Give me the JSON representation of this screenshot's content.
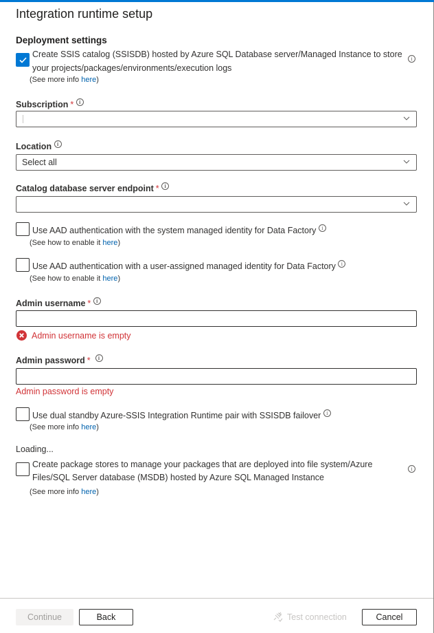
{
  "header": {
    "title": "Integration runtime setup",
    "accent_color": "#0078d4"
  },
  "section": {
    "title": "Deployment settings"
  },
  "ssisdb_checkbox": {
    "checked": true,
    "line1": "Create SSIS catalog (SSISDB) hosted by Azure SQL Database server/Managed Instance to store",
    "line2": "your projects/packages/environments/execution logs",
    "sub_prefix": "(See more info ",
    "sub_link": "here",
    "sub_suffix": ")"
  },
  "subscription": {
    "label": "Subscription",
    "required": "*",
    "value": ""
  },
  "location": {
    "label": "Location",
    "value": "Select all"
  },
  "endpoint": {
    "label": "Catalog database server endpoint",
    "required": "*",
    "value": ""
  },
  "aad_system": {
    "checked": false,
    "label": "Use AAD authentication with the system managed identity for Data Factory",
    "sub_prefix": "(See how to enable it ",
    "sub_link": "here",
    "sub_suffix": ")"
  },
  "aad_user": {
    "checked": false,
    "label": "Use AAD authentication with a user-assigned managed identity for Data Factory",
    "sub_prefix": "(See how to enable it ",
    "sub_link": "here",
    "sub_suffix": ")"
  },
  "admin_username": {
    "label": "Admin username",
    "required": "*",
    "value": "",
    "error": "Admin username is empty"
  },
  "admin_password": {
    "label": "Admin password",
    "required": "*",
    "value": "",
    "error": "Admin password is empty"
  },
  "dual_standby": {
    "checked": false,
    "label": "Use dual standby Azure-SSIS Integration Runtime pair with SSISDB failover",
    "sub_prefix": "(See more info ",
    "sub_link": "here",
    "sub_suffix": ")"
  },
  "loading_text": "Loading...",
  "package_stores": {
    "checked": false,
    "line1": "Create package stores to manage your packages that are deployed into file system/Azure",
    "line2": "Files/SQL Server database (MSDB) hosted by Azure SQL Managed Instance",
    "sub_prefix": "(See more info ",
    "sub_link": "here",
    "sub_suffix": ")"
  },
  "footer": {
    "continue_label": "Continue",
    "back_label": "Back",
    "test_connection_label": "Test connection",
    "cancel_label": "Cancel"
  },
  "colors": {
    "error": "#d13438",
    "link": "#0062ad",
    "primary": "#0078d4"
  },
  "info_glyph": "i"
}
